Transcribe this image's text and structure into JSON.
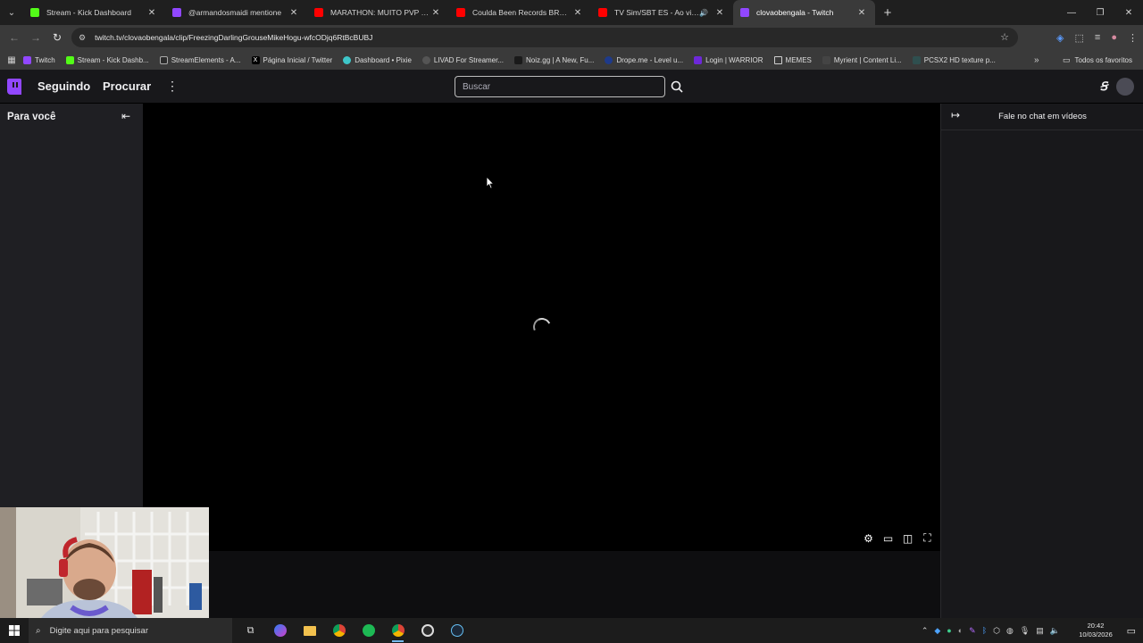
{
  "browser": {
    "tabs": [
      {
        "title": "Stream - Kick Dashboard",
        "favicon_color": "#53fc18",
        "active": false,
        "audio": false
      },
      {
        "title": "@armandosmaidi mentione",
        "favicon_color": "#9147ff",
        "active": false,
        "audio": false
      },
      {
        "title": "MARATHON: MUITO PVP e EVE",
        "favicon_color": "#ff0000",
        "active": false,
        "audio": false
      },
      {
        "title": "Coulda Been Records BROOKLY",
        "favicon_color": "#ff0000",
        "active": false,
        "audio": false
      },
      {
        "title": "TV Sim/SBT ES - Ao vivo - Y",
        "favicon_color": "#ff0000",
        "active": false,
        "audio": true
      },
      {
        "title": "clovaobengala - Twitch",
        "favicon_color": "#9147ff",
        "active": true,
        "audio": false
      }
    ],
    "url": "twitch.tv/clovaobengala/clip/FreezingDarlingGrouseMikeHogu-wfcODjq6RtBcBUBJ",
    "bookmarks": [
      {
        "label": "Twitch",
        "color": "#9147ff"
      },
      {
        "label": "Stream - Kick Dashb...",
        "color": "#53fc18"
      },
      {
        "label": "StreamElements - A...",
        "color": "#2b2b2b"
      },
      {
        "label": "Página Inicial / Twitter",
        "color": "#000000"
      },
      {
        "label": "Dashboard • Pixie",
        "color": "#3ec6c9"
      },
      {
        "label": "LIVAD For Streamer...",
        "color": "#555555"
      },
      {
        "label": "Noiz.gg | A New, Fu...",
        "color": "#1a1a1a"
      },
      {
        "label": "Drope.me - Level u...",
        "color": "#1e3a8a"
      },
      {
        "label": "Login | WARRIOR",
        "color": "#6d28d9"
      },
      {
        "label": "MEMES",
        "color": "folder"
      },
      {
        "label": "Myrient | Content Li...",
        "color": "#444444"
      },
      {
        "label": "PCSX2 HD texture p...",
        "color": "#2f4f4f"
      }
    ],
    "all_bookmarks": "Todos os favoritos"
  },
  "twitch": {
    "nav": {
      "following": "Seguindo",
      "browse": "Procurar",
      "search_placeholder": "Buscar"
    },
    "sidebar": {
      "title": "Para você"
    },
    "chat": {
      "title": "Fale no chat em vídeos"
    }
  },
  "taskbar": {
    "search_placeholder": "Digite aqui para pesquisar",
    "time": "20:42",
    "date": "10/03/2026"
  },
  "colors": {
    "twitch_purple": "#9147ff",
    "page_bg": "#0e0e10",
    "nav_bg": "#18181b",
    "sidebar_bg": "#1f1f23"
  }
}
